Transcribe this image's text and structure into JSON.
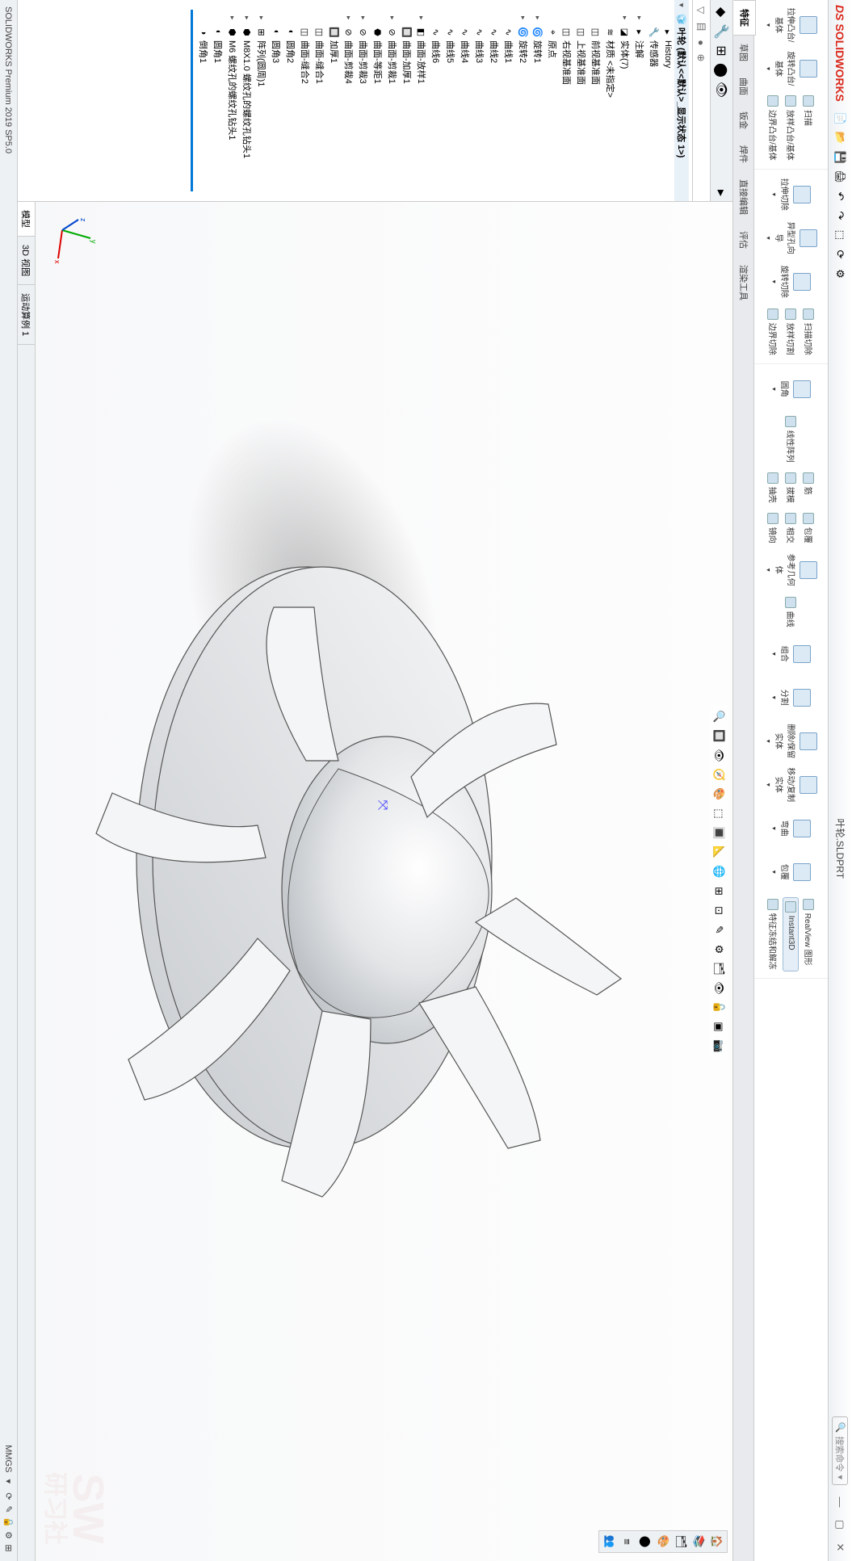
{
  "app": {
    "brand": "SOLIDWORKS",
    "ds": "DS"
  },
  "titlebar": {
    "doc_title": "叶轮.SLDPRT",
    "search_placeholder": "搜索命令",
    "search_icon": "🔍"
  },
  "qat": [
    "新建",
    "打开",
    "保存",
    "打印",
    "撤销",
    "重做",
    "选择",
    "重建",
    "选项"
  ],
  "ribbon": {
    "left_big": [
      {
        "label": "拉伸凸台/基体"
      },
      {
        "label": "旋转凸台/基体"
      }
    ],
    "left_small": [
      {
        "label": "扫描"
      },
      {
        "label": "放样凸台/基体"
      },
      {
        "label": "边界凸台/基体"
      }
    ],
    "mid_big": [
      {
        "label": "拉伸切除"
      },
      {
        "label": "异型孔向导"
      },
      {
        "label": "旋转切除"
      }
    ],
    "mid_small": [
      {
        "label": "扫描切除"
      },
      {
        "label": "放样切割"
      },
      {
        "label": "边界切除"
      }
    ],
    "right": [
      {
        "big": "圆角",
        "small": [
          "线性阵列"
        ]
      },
      {
        "col": [
          "筋",
          "拔模",
          "抽壳"
        ]
      },
      {
        "col": [
          "包覆",
          "相交",
          "镜向"
        ]
      },
      {
        "big": "参考几何体",
        "small": [
          "曲线"
        ]
      },
      {
        "plain": [
          "组合",
          "分割",
          "删除/保留实体",
          "移动/复制实体",
          "弯曲",
          "包覆"
        ]
      },
      {
        "col2": [
          "RealView 图形",
          "Instant3D",
          "特征冻结和解冻"
        ]
      }
    ],
    "active_button": "Instant3D"
  },
  "ribbon_tabs": [
    "特征",
    "草图",
    "曲面",
    "钣金",
    "焊件",
    "直接编辑",
    "评估",
    "渲染工具"
  ],
  "ribbon_tab_active": "特征",
  "panel_tabs": [
    "FeatureManager",
    "PropertyManager",
    "ConfigurationManager",
    "DimXpertManager",
    "DisplayManager"
  ],
  "panel_config_icons": [
    "▽",
    "目",
    "●",
    "⊕"
  ],
  "tree": {
    "root": "叶轮 (默认<<默认>_显示状态 1>)",
    "items": [
      {
        "icon": "▸",
        "label": "History",
        "ind": 1
      },
      {
        "icon": "🔧",
        "label": "传感器",
        "ind": 1
      },
      {
        "icon": "▸",
        "label": "注解",
        "caret": "▸",
        "ind": 1,
        "folder": true
      },
      {
        "icon": "◪",
        "label": "实体(7)",
        "caret": "▸",
        "ind": 1,
        "folder": true
      },
      {
        "icon": "≋",
        "label": "材质 <未指定>",
        "ind": 1
      },
      {
        "icon": "◫",
        "label": "前视基准面",
        "ind": 1
      },
      {
        "icon": "◫",
        "label": "上视基准面",
        "ind": 1
      },
      {
        "icon": "◫",
        "label": "右视基准面",
        "ind": 1
      },
      {
        "icon": "⌖",
        "label": "原点",
        "ind": 1
      },
      {
        "icon": "🌀",
        "label": "旋转1",
        "caret": "▸",
        "ind": 1
      },
      {
        "icon": "🌀",
        "label": "旋转2",
        "caret": "▸",
        "ind": 1
      },
      {
        "icon": "∿",
        "label": "曲线1",
        "ind": 1
      },
      {
        "icon": "∿",
        "label": "曲线2",
        "ind": 1
      },
      {
        "icon": "∿",
        "label": "曲线3",
        "ind": 1
      },
      {
        "icon": "∿",
        "label": "曲线4",
        "ind": 1
      },
      {
        "icon": "∿",
        "label": "曲线5",
        "ind": 1
      },
      {
        "icon": "∿",
        "label": "曲线6",
        "ind": 1
      },
      {
        "icon": "◧",
        "label": "曲面-放样1",
        "caret": "▸",
        "ind": 1
      },
      {
        "icon": "🔲",
        "label": "曲面-加厚1",
        "ind": 1
      },
      {
        "icon": "⊘",
        "label": "曲面-剪裁1",
        "caret": "▸",
        "ind": 1
      },
      {
        "icon": "⬣",
        "label": "曲面-等距1",
        "ind": 1
      },
      {
        "icon": "⊘",
        "label": "曲面-剪裁3",
        "caret": "▸",
        "ind": 1
      },
      {
        "icon": "⊘",
        "label": "曲面-剪裁4",
        "caret": "▸",
        "ind": 1
      },
      {
        "icon": "🔲",
        "label": "加厚1",
        "ind": 1
      },
      {
        "icon": "◫",
        "label": "曲面-缝合1",
        "ind": 1
      },
      {
        "icon": "◫",
        "label": "曲面-缝合2",
        "ind": 1
      },
      {
        "icon": "◐",
        "label": "圆角2",
        "ind": 1
      },
      {
        "icon": "◐",
        "label": "圆角3",
        "ind": 1
      },
      {
        "icon": "⊞",
        "label": "阵列(圆周)1",
        "caret": "▸",
        "ind": 1
      },
      {
        "icon": "⬢",
        "label": "M8X1.0 螺纹孔的螺纹孔钻头1",
        "caret": "▸",
        "ind": 1
      },
      {
        "icon": "⬢",
        "label": "M6 螺纹孔的螺纹孔钻头1",
        "caret": "▸",
        "ind": 1
      },
      {
        "icon": "◐",
        "label": "圆角1",
        "ind": 1
      },
      {
        "icon": "◑",
        "label": "倒角1",
        "ind": 1
      }
    ]
  },
  "heads_up": [
    "🔍",
    "🔲",
    "👁",
    "🧭",
    "🎨",
    "⬚",
    "🔳",
    "📐",
    "🌐",
    "⊞",
    "⊡",
    "✎",
    "⚙",
    "🗂",
    "👁",
    "🔓",
    "▣",
    "📷"
  ],
  "bottom_tabs": [
    "模型",
    "3D 视图",
    "运动算例 1"
  ],
  "bottom_tab_active": "模型",
  "statusbar": {
    "left": "SOLIDWORKS Premium 2019 SP5.0",
    "right": "MMGS",
    "icons": [
      "⟳",
      "✎",
      "🔒",
      "⚙",
      "⊞"
    ]
  },
  "triad": {
    "x": "x",
    "y": "y",
    "z": "z"
  },
  "watermark": {
    "line1": "SW",
    "line2": "研习社"
  }
}
